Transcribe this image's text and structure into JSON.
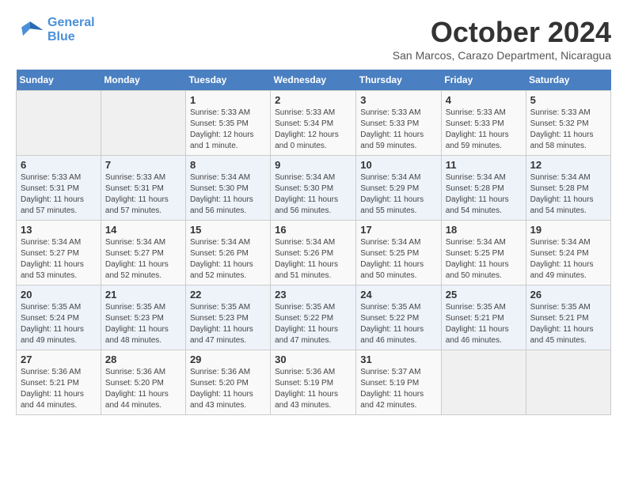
{
  "header": {
    "logo_line1": "General",
    "logo_line2": "Blue",
    "month_title": "October 2024",
    "subtitle": "San Marcos, Carazo Department, Nicaragua"
  },
  "weekdays": [
    "Sunday",
    "Monday",
    "Tuesday",
    "Wednesday",
    "Thursday",
    "Friday",
    "Saturday"
  ],
  "weeks": [
    [
      {
        "day": "",
        "info": ""
      },
      {
        "day": "",
        "info": ""
      },
      {
        "day": "1",
        "info": "Sunrise: 5:33 AM\nSunset: 5:35 PM\nDaylight: 12 hours and 1 minute."
      },
      {
        "day": "2",
        "info": "Sunrise: 5:33 AM\nSunset: 5:34 PM\nDaylight: 12 hours and 0 minutes."
      },
      {
        "day": "3",
        "info": "Sunrise: 5:33 AM\nSunset: 5:33 PM\nDaylight: 11 hours and 59 minutes."
      },
      {
        "day": "4",
        "info": "Sunrise: 5:33 AM\nSunset: 5:33 PM\nDaylight: 11 hours and 59 minutes."
      },
      {
        "day": "5",
        "info": "Sunrise: 5:33 AM\nSunset: 5:32 PM\nDaylight: 11 hours and 58 minutes."
      }
    ],
    [
      {
        "day": "6",
        "info": "Sunrise: 5:33 AM\nSunset: 5:31 PM\nDaylight: 11 hours and 57 minutes."
      },
      {
        "day": "7",
        "info": "Sunrise: 5:33 AM\nSunset: 5:31 PM\nDaylight: 11 hours and 57 minutes."
      },
      {
        "day": "8",
        "info": "Sunrise: 5:34 AM\nSunset: 5:30 PM\nDaylight: 11 hours and 56 minutes."
      },
      {
        "day": "9",
        "info": "Sunrise: 5:34 AM\nSunset: 5:30 PM\nDaylight: 11 hours and 56 minutes."
      },
      {
        "day": "10",
        "info": "Sunrise: 5:34 AM\nSunset: 5:29 PM\nDaylight: 11 hours and 55 minutes."
      },
      {
        "day": "11",
        "info": "Sunrise: 5:34 AM\nSunset: 5:28 PM\nDaylight: 11 hours and 54 minutes."
      },
      {
        "day": "12",
        "info": "Sunrise: 5:34 AM\nSunset: 5:28 PM\nDaylight: 11 hours and 54 minutes."
      }
    ],
    [
      {
        "day": "13",
        "info": "Sunrise: 5:34 AM\nSunset: 5:27 PM\nDaylight: 11 hours and 53 minutes."
      },
      {
        "day": "14",
        "info": "Sunrise: 5:34 AM\nSunset: 5:27 PM\nDaylight: 11 hours and 52 minutes."
      },
      {
        "day": "15",
        "info": "Sunrise: 5:34 AM\nSunset: 5:26 PM\nDaylight: 11 hours and 52 minutes."
      },
      {
        "day": "16",
        "info": "Sunrise: 5:34 AM\nSunset: 5:26 PM\nDaylight: 11 hours and 51 minutes."
      },
      {
        "day": "17",
        "info": "Sunrise: 5:34 AM\nSunset: 5:25 PM\nDaylight: 11 hours and 50 minutes."
      },
      {
        "day": "18",
        "info": "Sunrise: 5:34 AM\nSunset: 5:25 PM\nDaylight: 11 hours and 50 minutes."
      },
      {
        "day": "19",
        "info": "Sunrise: 5:34 AM\nSunset: 5:24 PM\nDaylight: 11 hours and 49 minutes."
      }
    ],
    [
      {
        "day": "20",
        "info": "Sunrise: 5:35 AM\nSunset: 5:24 PM\nDaylight: 11 hours and 49 minutes."
      },
      {
        "day": "21",
        "info": "Sunrise: 5:35 AM\nSunset: 5:23 PM\nDaylight: 11 hours and 48 minutes."
      },
      {
        "day": "22",
        "info": "Sunrise: 5:35 AM\nSunset: 5:23 PM\nDaylight: 11 hours and 47 minutes."
      },
      {
        "day": "23",
        "info": "Sunrise: 5:35 AM\nSunset: 5:22 PM\nDaylight: 11 hours and 47 minutes."
      },
      {
        "day": "24",
        "info": "Sunrise: 5:35 AM\nSunset: 5:22 PM\nDaylight: 11 hours and 46 minutes."
      },
      {
        "day": "25",
        "info": "Sunrise: 5:35 AM\nSunset: 5:21 PM\nDaylight: 11 hours and 46 minutes."
      },
      {
        "day": "26",
        "info": "Sunrise: 5:35 AM\nSunset: 5:21 PM\nDaylight: 11 hours and 45 minutes."
      }
    ],
    [
      {
        "day": "27",
        "info": "Sunrise: 5:36 AM\nSunset: 5:21 PM\nDaylight: 11 hours and 44 minutes."
      },
      {
        "day": "28",
        "info": "Sunrise: 5:36 AM\nSunset: 5:20 PM\nDaylight: 11 hours and 44 minutes."
      },
      {
        "day": "29",
        "info": "Sunrise: 5:36 AM\nSunset: 5:20 PM\nDaylight: 11 hours and 43 minutes."
      },
      {
        "day": "30",
        "info": "Sunrise: 5:36 AM\nSunset: 5:19 PM\nDaylight: 11 hours and 43 minutes."
      },
      {
        "day": "31",
        "info": "Sunrise: 5:37 AM\nSunset: 5:19 PM\nDaylight: 11 hours and 42 minutes."
      },
      {
        "day": "",
        "info": ""
      },
      {
        "day": "",
        "info": ""
      }
    ]
  ]
}
